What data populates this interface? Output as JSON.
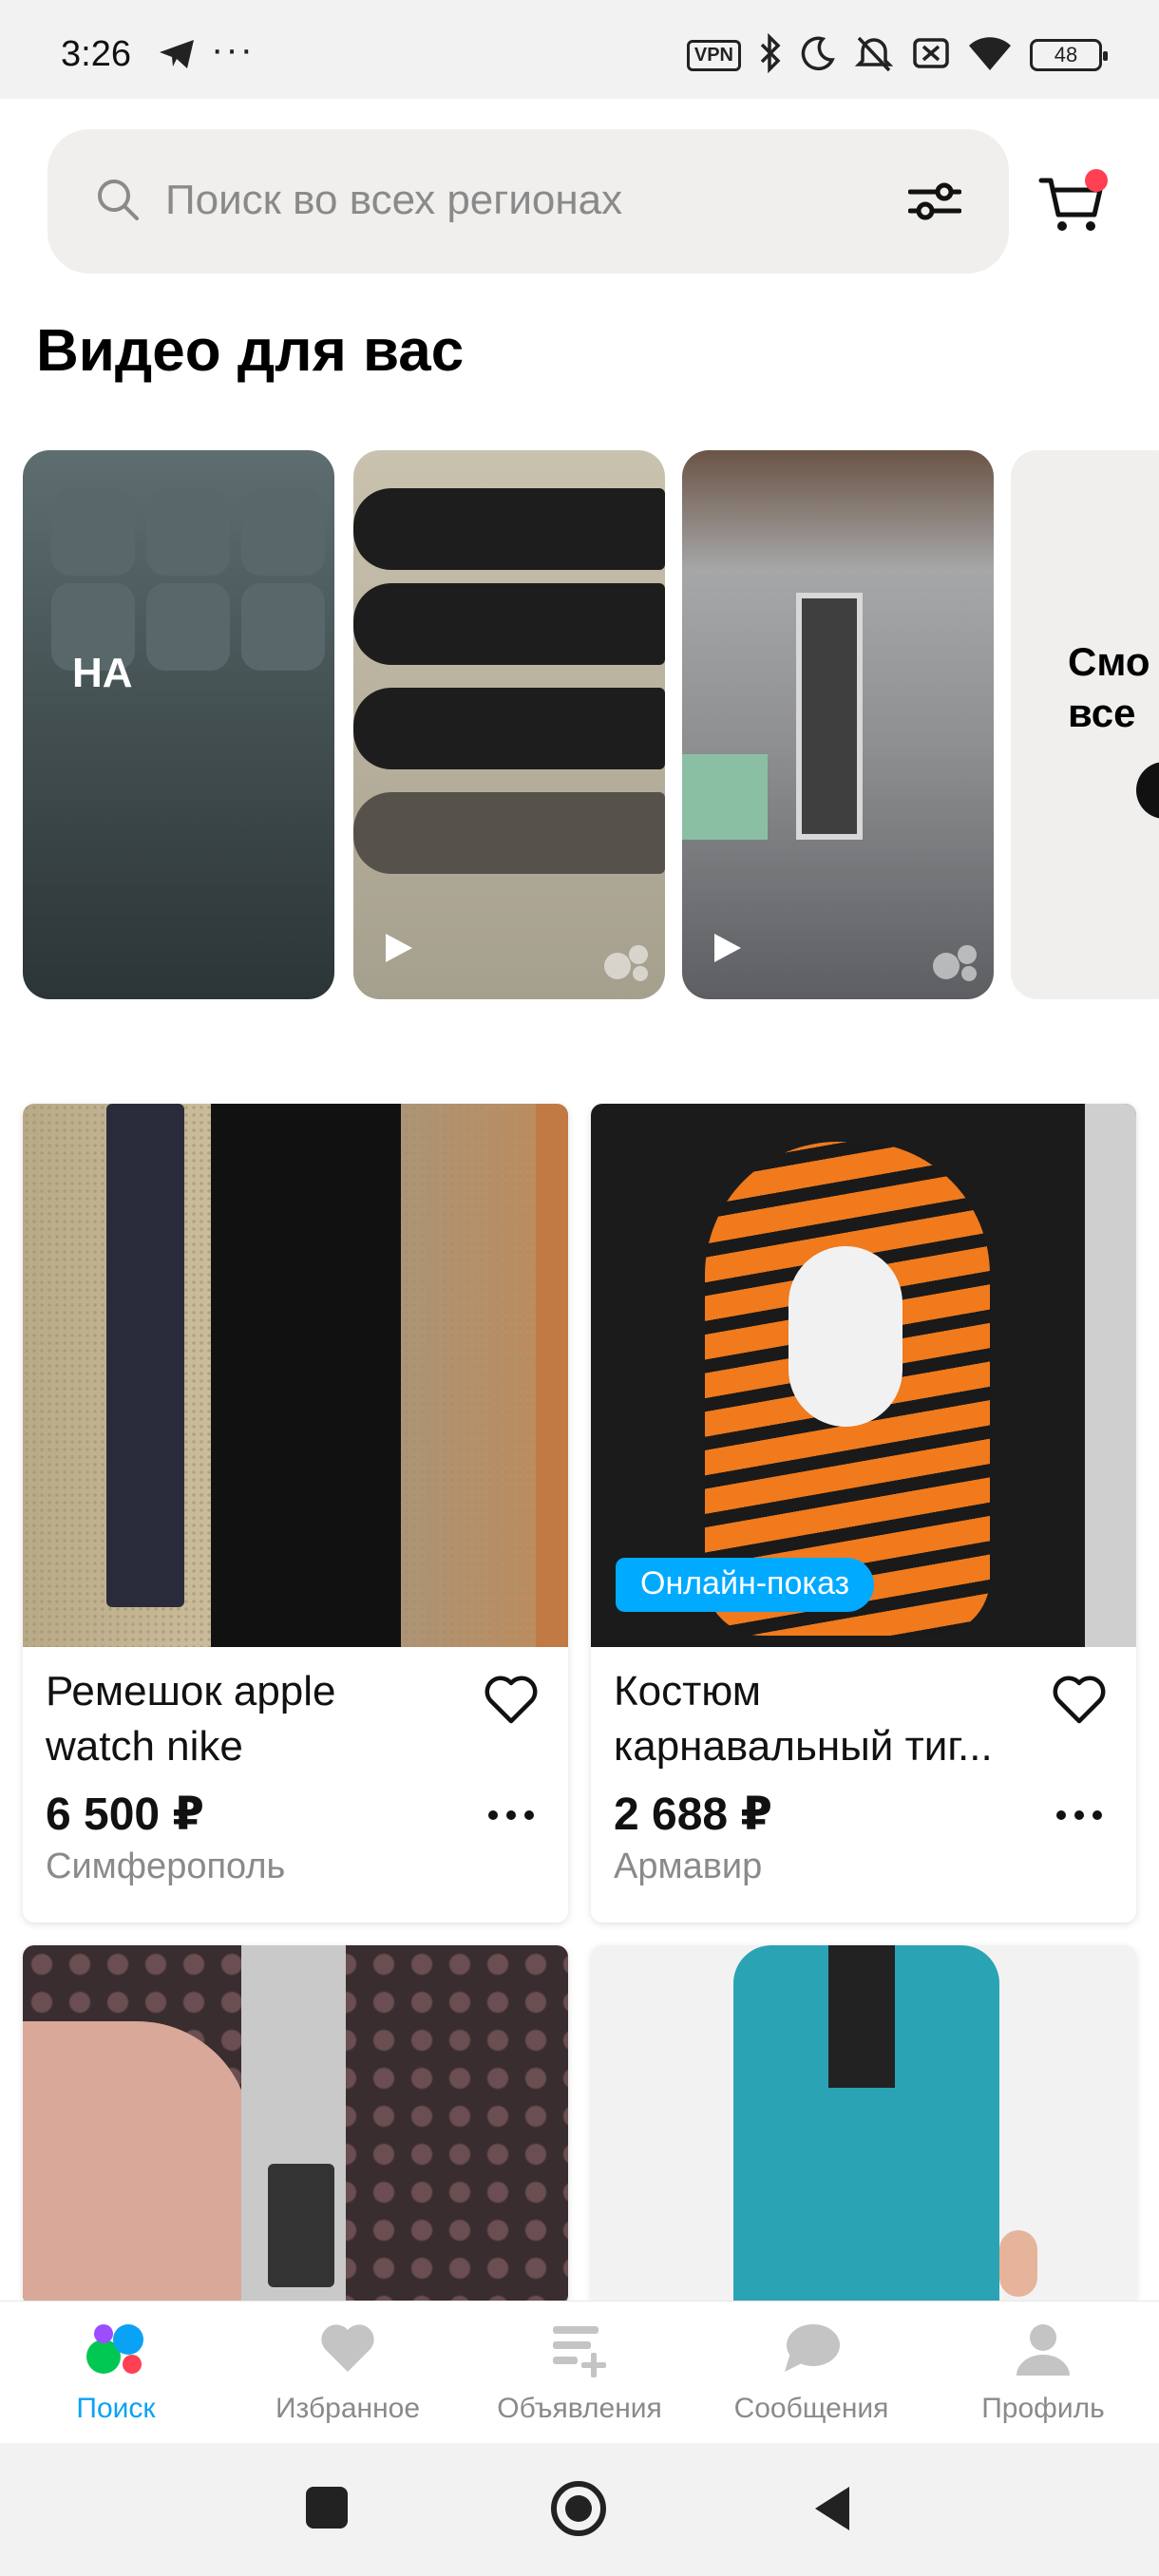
{
  "status_bar": {
    "time": "3:26",
    "dots": "···",
    "vpn": "VPN",
    "battery": "48"
  },
  "search": {
    "placeholder": "Поиск во всех регионах"
  },
  "videos": {
    "title": "Видео для вас",
    "items": [
      {
        "overlay_text": "НА"
      },
      {
        "overlay_text": ""
      },
      {
        "overlay_text": ""
      },
      {
        "overlay_text": "Смотреть все"
      }
    ],
    "see_all_line1": "Смо",
    "see_all_line2": "все"
  },
  "products": [
    {
      "title_line1": "Ремешок apple",
      "title_line2": "watch nike",
      "price": "6 500 ₽",
      "city": "Симферополь",
      "badge": ""
    },
    {
      "title_line1": "Костюм",
      "title_line2": "карнавальный тиг...",
      "price": "2 688 ₽",
      "city": "Армавир",
      "badge": "Онлайн-показ"
    }
  ],
  "bottom_nav": {
    "items": [
      {
        "label": "Поиск",
        "active": true
      },
      {
        "label": "Избранное",
        "active": false
      },
      {
        "label": "Объявления",
        "active": false
      },
      {
        "label": "Сообщения",
        "active": false
      },
      {
        "label": "Профиль",
        "active": false
      }
    ]
  },
  "colors": {
    "accent": "#0aa2f5",
    "badge": "#00aaff",
    "cart_dot": "#ff4053",
    "search_bg": "#f0efed"
  }
}
